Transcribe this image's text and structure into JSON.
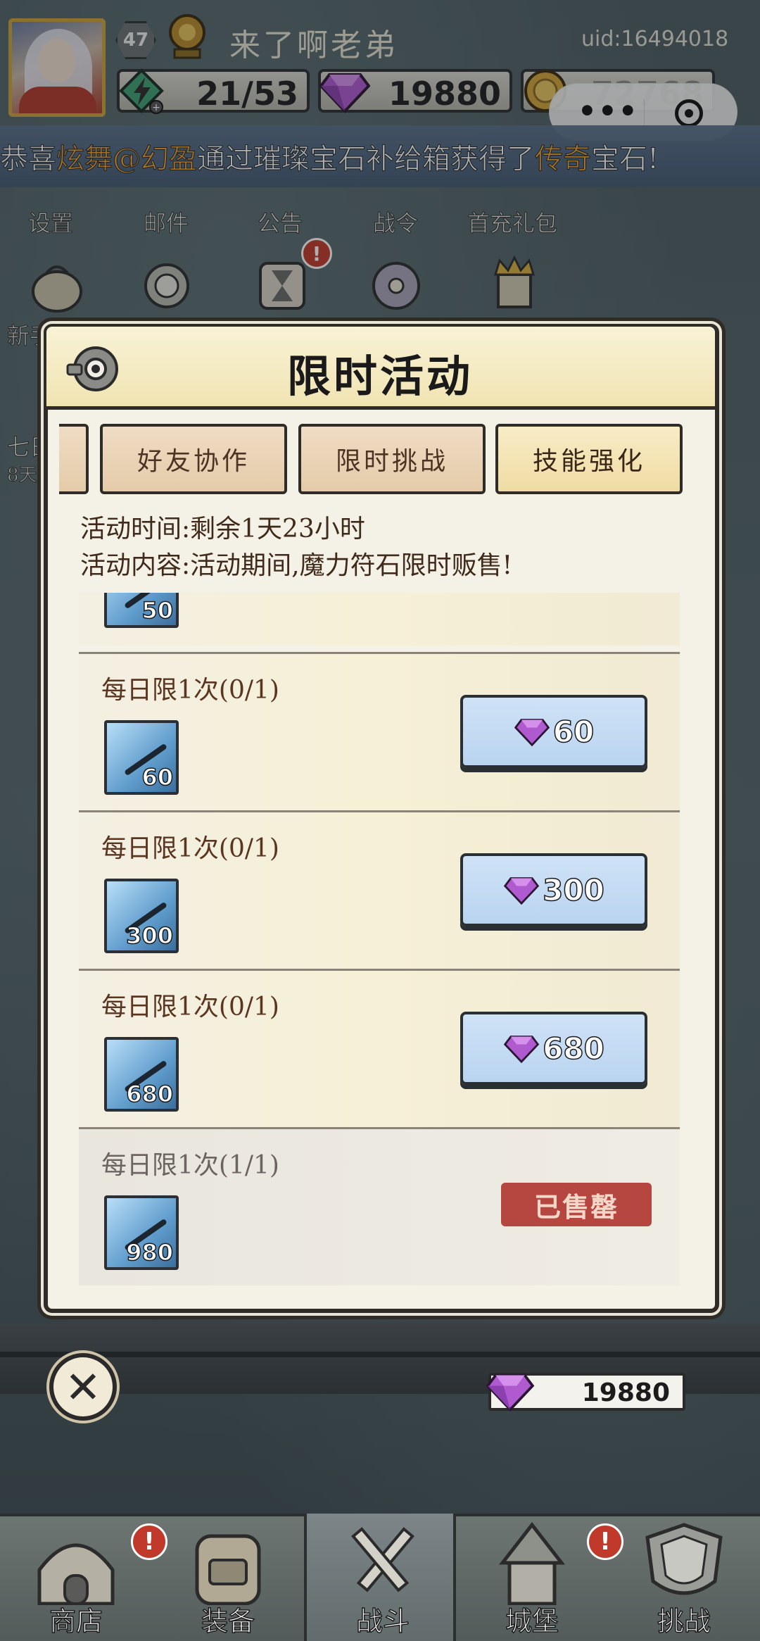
{
  "header": {
    "level": "47",
    "player_name": "来了啊老弟",
    "uid": "uid:16494018",
    "energy": "21/53",
    "gems": "19880",
    "gold": "72768"
  },
  "marquee": {
    "prefix": "恭喜",
    "player": "炫舞@幻盈",
    "middle": "通过璀璨宝石补给箱获得了",
    "rarity": "传奇",
    "suffix": "宝石!"
  },
  "menu": {
    "settings": "设置",
    "mail": "邮件",
    "notice": "公告",
    "battle_pass": "战令",
    "first_recharge": "首充礼包",
    "newbie_partial": "新手",
    "seven_day_partial": "七日",
    "eight_day_partial": "8天"
  },
  "popup": {
    "title": "限时活动",
    "tabs": [
      "好友协作",
      "限时挑战",
      "技能强化"
    ],
    "active_tab": "技能强化",
    "event_time": "活动时间:剩余1天23小时",
    "event_content": "活动内容:活动期间,魔力符石限时贩售!",
    "rows": [
      {
        "title": "",
        "item_count": "50",
        "price": "",
        "sold": false
      },
      {
        "title": "每日限1次(0/1)",
        "item_count": "60",
        "price": "60",
        "sold": false
      },
      {
        "title": "每日限1次(0/1)",
        "item_count": "300",
        "price": "300",
        "sold": false
      },
      {
        "title": "每日限1次(0/1)",
        "item_count": "680",
        "price": "680",
        "sold": false
      },
      {
        "title": "每日限1次(1/1)",
        "item_count": "980",
        "price": "",
        "sold": true,
        "sold_label": "已售罄"
      }
    ]
  },
  "bottom": {
    "gem_balance": "19880"
  },
  "nav": [
    {
      "label": "商店",
      "badge": "!"
    },
    {
      "label": "装备",
      "badge": ""
    },
    {
      "label": "战斗",
      "badge": ""
    },
    {
      "label": "城堡",
      "badge": "!"
    },
    {
      "label": "挑战",
      "badge": ""
    }
  ],
  "colors": {
    "highlight_orange": "#f4a32e",
    "buy_button": "#c6dcf4",
    "sold_badge": "#b64640",
    "gem_purple": "#b05ad0"
  }
}
